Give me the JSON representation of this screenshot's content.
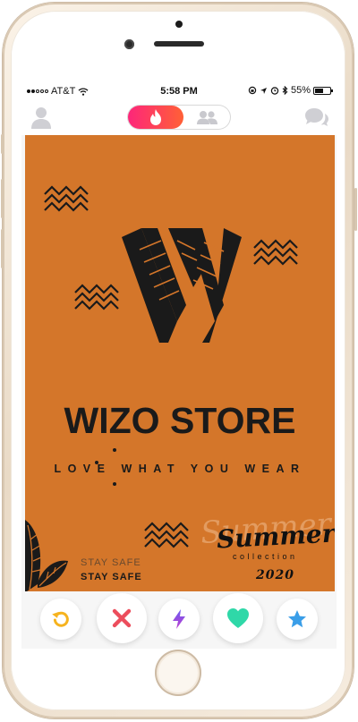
{
  "status_bar": {
    "carrier": "AT&T",
    "time": "5:58 PM",
    "battery": "55%",
    "battery_level": 0.55,
    "signal_bars": 2
  },
  "top_bar": {
    "left_icon": "profile-icon",
    "toggle_active_icon": "flame-icon",
    "toggle_inactive_icon": "group-icon",
    "right_icon": "chat-icon",
    "accent_gradient": [
      "#fd267a",
      "#ff6036"
    ]
  },
  "card": {
    "background": "#d4762a",
    "brand": "WIZO STORE",
    "tagline": "LOVE WHAT YOU WEAR",
    "stay_safe_1": "STAY SAFE",
    "stay_safe_2": "STAY SAFE",
    "summer_ghost": "Summer",
    "summer": "Summer",
    "collection": "collection",
    "year": "2020"
  },
  "actions": [
    {
      "icon": "rewind-icon",
      "color": "#f6b31e"
    },
    {
      "icon": "nope-icon",
      "color": "#ec4d5c"
    },
    {
      "icon": "boost-icon",
      "color": "#a34ad5"
    },
    {
      "icon": "like-icon",
      "color": "#2fd8a8"
    },
    {
      "icon": "super-like-icon",
      "color": "#3a9ee8"
    }
  ]
}
